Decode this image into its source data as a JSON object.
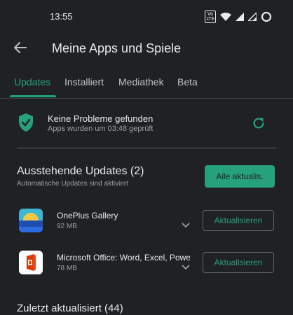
{
  "status_bar": {
    "time": "13:55",
    "volte": "Vo LTE"
  },
  "header": {
    "title": "Meine Apps und Spiele"
  },
  "tabs": [
    {
      "label": "Updates",
      "active": true
    },
    {
      "label": "Installiert",
      "active": false
    },
    {
      "label": "Mediathek",
      "active": false
    },
    {
      "label": "Beta",
      "active": false
    }
  ],
  "protect": {
    "title": "Keine Probleme gefunden",
    "subtitle": "Apps wurden um 03:48 geprüft"
  },
  "pending": {
    "title": "Ausstehende Updates (2)",
    "subtitle": "Automatische Updates sind aktiviert",
    "update_all_label": "Alle aktualis."
  },
  "apps": [
    {
      "name": "OnePlus Gallery",
      "size": "92 MB",
      "button": "Aktualisieren",
      "icon": "oneplus-gallery-icon"
    },
    {
      "name": "Microsoft Office: Word, Excel, Power",
      "size": "78 MB",
      "button": "Aktualisieren",
      "icon": "microsoft-office-icon"
    }
  ],
  "recent": {
    "title": "Zuletzt aktualisiert (44)"
  },
  "colors": {
    "accent": "#26a17b",
    "background": "#202124"
  }
}
